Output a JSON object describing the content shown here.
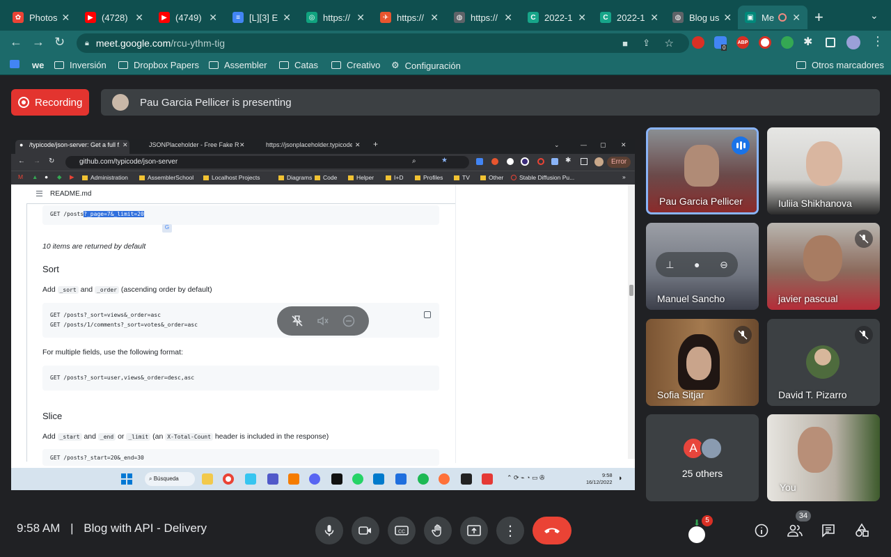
{
  "browser": {
    "tabs": [
      {
        "label": "Photos",
        "color": "#ea4335"
      },
      {
        "label": "(4728)",
        "color": "#ff0000"
      },
      {
        "label": "(4749)",
        "color": "#ff0000"
      },
      {
        "label": "[L][3] E",
        "color": "#4285f4"
      },
      {
        "label": "https://",
        "color": "#10a37f"
      },
      {
        "label": "https://",
        "color": "#e8552e"
      },
      {
        "label": "https://",
        "color": "#5f6368"
      },
      {
        "label": "2022-1",
        "color": "#17a589"
      },
      {
        "label": "2022-1",
        "color": "#17a589"
      },
      {
        "label": "Blog us",
        "color": "#5f6368"
      },
      {
        "label": "Me",
        "color": "#00897b"
      }
    ],
    "url_host": "meet.google.com",
    "url_path": "/rcu-ythm-tig",
    "bookmarks": [
      "Inversión",
      "Dropbox Papers",
      "Assembler",
      "Catas",
      "Creativo",
      "Configuración"
    ],
    "other_bookmarks": "Otros marcadores",
    "ext_badge": "0",
    "abp": "ABP"
  },
  "meet": {
    "recording_label": "Recording",
    "presenting_text": "Pau Garcia Pellicer is presenting",
    "time": "9:58 AM",
    "separator": "|",
    "meeting_title": "Blog with API - Delivery",
    "participant_count": "34",
    "activity_badge": "5",
    "participants": [
      {
        "name": "Pau Garcia Pellicer",
        "status": "speaking"
      },
      {
        "name": "Iuliia Shikhanova",
        "status": "on"
      },
      {
        "name": "Manuel Sancho",
        "status": "on"
      },
      {
        "name": "javier pascual",
        "status": "muted"
      },
      {
        "name": "Sofia Sitjar",
        "status": "muted"
      },
      {
        "name": "David T. Pizarro",
        "status": "muted"
      },
      {
        "name": "25 others",
        "status": "group",
        "initial": "A"
      },
      {
        "name": "You",
        "status": "on"
      }
    ]
  },
  "shared_screen": {
    "tabs": [
      "/typicode/json-server: Get a full f...",
      "JSONPlaceholder - Free Fake REST...",
      "https://jsonplaceholder.typicode..."
    ],
    "url": "github.com/typicode/json-server",
    "error_label": "Error",
    "bookmarks": [
      "Administration",
      "AssemblerSchool",
      "Localhost Projects",
      "Diagrams",
      "Code",
      "Helper",
      "I+D",
      "Profiles",
      "TV",
      "Other",
      "Stable Diffusion Pu..."
    ],
    "readme_title": "README.md",
    "code_paginate_prefix": "GET /posts",
    "code_paginate_highlight": "?_page=7&_limit=20",
    "paginate_note": "10 items are returned by default",
    "sort_heading": "Sort",
    "sort_desc": {
      "add": "Add",
      "p1": "_sort",
      "and": "and",
      "p2": "_order",
      "rest": "(ascending order by default)"
    },
    "sort_code_1": "GET /posts?_sort=views&_order=asc",
    "sort_code_2": "GET /posts/1/comments?_sort=votes&_order=asc",
    "multi_fields": "For multiple fields, use the following format:",
    "multi_code": "GET /posts?_sort=user,views&_order=desc,asc",
    "slice_heading": "Slice",
    "slice_desc": {
      "add": "Add",
      "p1": "_start",
      "and": "and",
      "p2": "_end",
      "or": "or",
      "p3": "_limit",
      "open": "(an",
      "p4": "X-Total-Count",
      "rest": "header is included in the response)"
    },
    "slice_code": "GET /posts?_start=20&_end=30",
    "taskbar_search": "Búsqueda",
    "taskbar_time": "9:58",
    "taskbar_date": "16/12/2022"
  },
  "colors": {
    "accent": "#1a73e8",
    "leave": "#ea4335",
    "recording": "#e3342f"
  }
}
